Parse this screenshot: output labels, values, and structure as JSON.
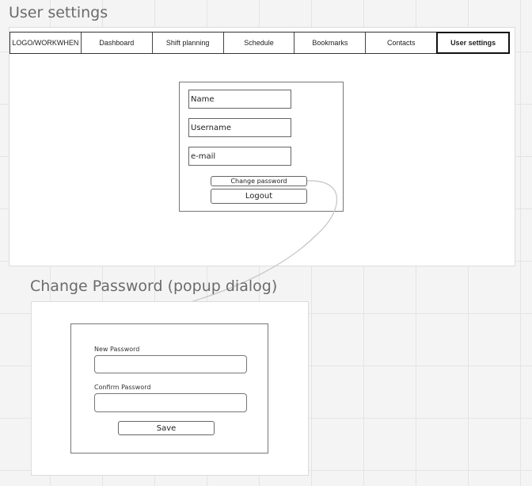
{
  "settings": {
    "heading": "User settings",
    "nav": [
      {
        "label": "LOGO/WORKWHEN",
        "active": false
      },
      {
        "label": "Dashboard",
        "active": false
      },
      {
        "label": "Shift planning",
        "active": false
      },
      {
        "label": "Schedule",
        "active": false
      },
      {
        "label": "Bookmarks",
        "active": false
      },
      {
        "label": "Contacts",
        "active": false
      },
      {
        "label": "User settings",
        "active": true
      }
    ],
    "form": {
      "name_value": "Name",
      "username_value": "Username",
      "email_value": "e-mail",
      "change_password_label": "Change password",
      "logout_label": "Logout"
    }
  },
  "popup": {
    "heading": "Change Password (popup dialog)",
    "new_password_label": "New Password",
    "confirm_password_label": "Confirm Password",
    "save_label": "Save"
  }
}
